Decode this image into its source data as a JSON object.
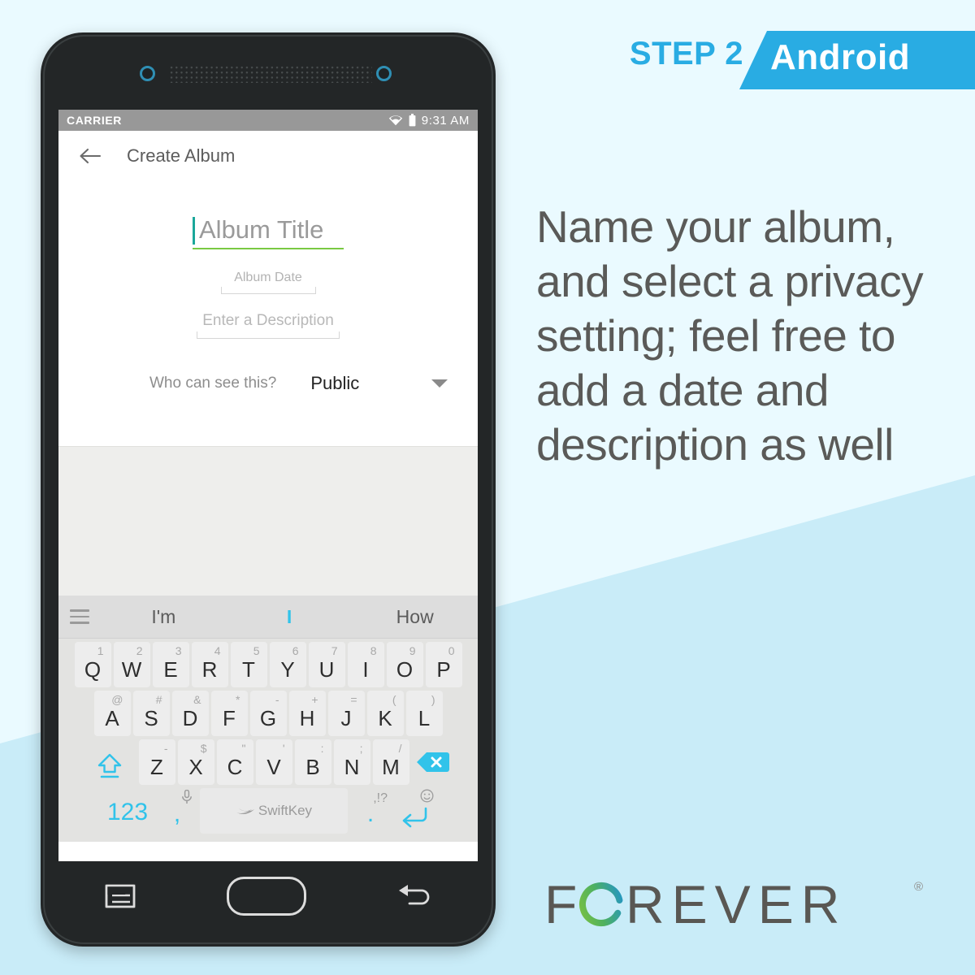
{
  "banner": {
    "step_label": "STEP 2",
    "platform_label": "Android",
    "accent_color": "#29ace3",
    "banner_color": "#29ace3"
  },
  "copy": {
    "text": "Name your album, and select a privacy setting; feel free to add a date and description as well"
  },
  "logo": {
    "text": "FOREVER",
    "registered_mark": "®"
  },
  "phone": {
    "status_bar": {
      "carrier": "CARRIER",
      "time": "9:31 AM",
      "wifi_icon": "wifi-icon",
      "battery_icon": "battery-icon"
    },
    "app_bar": {
      "back_icon": "back-arrow-icon",
      "title": "Create Album"
    },
    "form": {
      "album_title_placeholder": "Album Title",
      "album_title_value": "",
      "album_title_underline_color": "#7ac943",
      "caret_color": "#1aa79a",
      "album_date_placeholder": "Album Date",
      "album_date_value": "",
      "description_placeholder": "Enter a Description",
      "description_value": "",
      "privacy_label": "Who can see this?",
      "privacy_value": "Public",
      "privacy_caret_icon": "chevron-down-icon"
    },
    "keyboard": {
      "menu_icon": "hamburger-menu-icon",
      "suggestions": [
        "I'm",
        "I",
        "How"
      ],
      "active_suggestion_index": 1,
      "accent_color": "#31c3ea",
      "row1": [
        {
          "main": "Q",
          "sup": "1"
        },
        {
          "main": "W",
          "sup": "2"
        },
        {
          "main": "E",
          "sup": "3"
        },
        {
          "main": "R",
          "sup": "4"
        },
        {
          "main": "T",
          "sup": "5"
        },
        {
          "main": "Y",
          "sup": "6"
        },
        {
          "main": "U",
          "sup": "7"
        },
        {
          "main": "I",
          "sup": "8"
        },
        {
          "main": "O",
          "sup": "9"
        },
        {
          "main": "P",
          "sup": "0"
        }
      ],
      "row2": [
        {
          "main": "A",
          "sup": "@"
        },
        {
          "main": "S",
          "sup": "#"
        },
        {
          "main": "D",
          "sup": "&"
        },
        {
          "main": "F",
          "sup": "*"
        },
        {
          "main": "G",
          "sup": "-"
        },
        {
          "main": "H",
          "sup": "+"
        },
        {
          "main": "J",
          "sup": "="
        },
        {
          "main": "K",
          "sup": "("
        },
        {
          "main": "L",
          "sup": ")"
        }
      ],
      "row3": [
        {
          "main": "Z",
          "sup": "-"
        },
        {
          "main": "X",
          "sup": "$"
        },
        {
          "main": "C",
          "sup": "\""
        },
        {
          "main": "V",
          "sup": "'"
        },
        {
          "main": "B",
          "sup": ":"
        },
        {
          "main": "N",
          "sup": ";"
        },
        {
          "main": "M",
          "sup": "/"
        }
      ],
      "shift_icon": "shift-arrow-icon",
      "backspace_icon": "backspace-icon",
      "numeric_key_label": "123",
      "comma_key_label": ",",
      "mic_icon": "microphone-icon",
      "space_key_label": "SwiftKey",
      "swiftkey_logo_icon": "swiftkey-logo-icon",
      "period_key_label": ".",
      "punctuation_sup": ",!?",
      "emoji_icon": "smiley-icon",
      "enter_icon": "enter-arrow-icon"
    },
    "nav_bar": {
      "menu_icon": "nav-menu-icon",
      "home_icon": "nav-home-icon",
      "back_icon": "nav-back-icon"
    }
  }
}
